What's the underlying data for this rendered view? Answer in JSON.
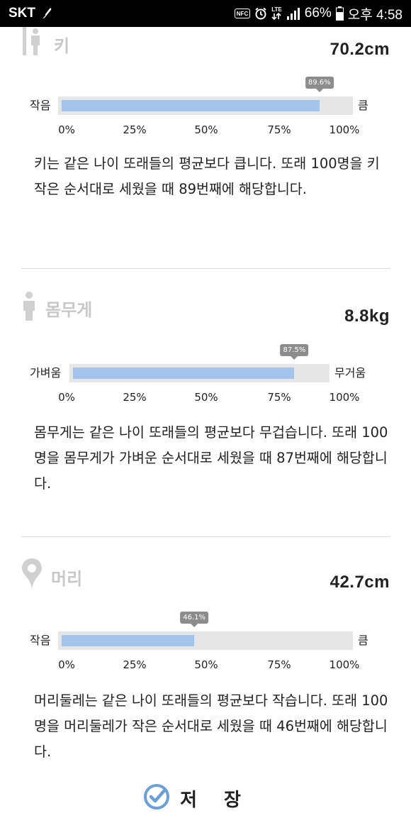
{
  "status_bar": {
    "carrier": "SKT",
    "nfc": "NFC",
    "lte": "LTE",
    "battery": "66%",
    "time": "오후 4:58"
  },
  "scale_ticks": [
    "0%",
    "25%",
    "50%",
    "75%",
    "100%"
  ],
  "sections": [
    {
      "label": "키",
      "value": "70.2cm",
      "left_label": "작음",
      "right_label": "큼",
      "percent_label": "89.6%",
      "percent": 89.6,
      "description": "키는 같은 나이 또래들의 평균보다 큽니다. 또래 100명을 키 작은 순서대로 세웠을 때 89번째에 해당합니다."
    },
    {
      "label": "몸무게",
      "value": "8.8kg",
      "left_label": "가벼움",
      "right_label": "무거움",
      "percent_label": "87.5%",
      "percent": 87.5,
      "description": "몸무게는 같은 나이 또래들의 평균보다 무겁습니다. 또래 100명을 몸무게가 가벼운 순서대로 세웠을 때 87번째에 해당합니다."
    },
    {
      "label": "머리",
      "value": "42.7cm",
      "left_label": "작음",
      "right_label": "큼",
      "percent_label": "46.1%",
      "percent": 46.1,
      "description": "머리둘레는 같은 나이 또래들의 평균보다 작습니다. 또래 100명을 머리둘레가 작은 순서대로 세웠을 때 46번째에 해당합니다."
    }
  ],
  "save_button": {
    "label": "저장"
  },
  "colors": {
    "bar_fill": "#a3c5eb",
    "bar_track": "#e6e6e6",
    "bubble": "#8c8c8c",
    "check": "#6a9fd8"
  }
}
